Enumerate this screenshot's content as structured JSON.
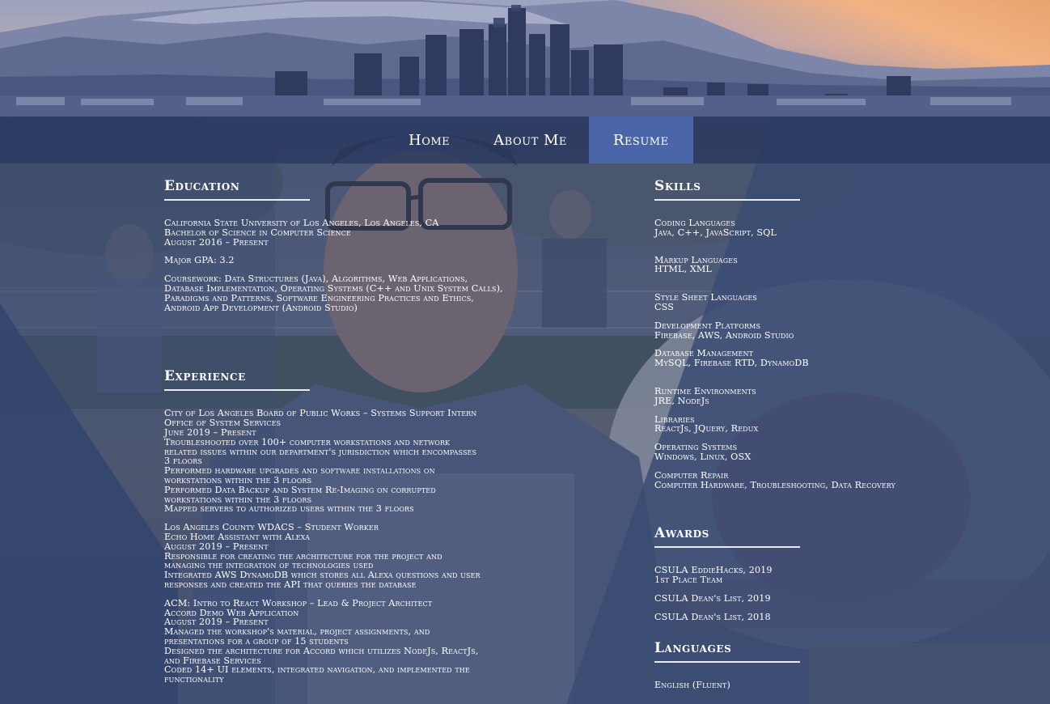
{
  "nav": {
    "items": [
      {
        "label": "Home",
        "active": false
      },
      {
        "label": "About Me",
        "active": false
      },
      {
        "label": "Resume",
        "active": true
      }
    ]
  },
  "education": {
    "title": "Education",
    "school": "California State University of Los Angeles, Los Angeles, CA",
    "degree": "Bachelor of Science  in Computer Science",
    "dates": "August 2016 – Present",
    "gpa": "Major GPA: 3.2",
    "coursework": [
      "Coursework: Data Structures (Java), Algorithms, Web Applications,",
      "Database Implementation, Operating Systems (C++ and Unix System Calls),",
      "Paradigms and Patterns, Software Engineering Practices and Ethics,",
      "Android App Development (Android Studio)"
    ]
  },
  "experience": {
    "title": "Experience",
    "jobs": [
      {
        "lines": [
          "City of Los Angeles Board of Public Works – Systems Support Intern",
          "Office of System Services",
          "June 2019 – Present",
          "Troubleshooted over 100+ computer workstations and network",
          "related issues within our department's jurisdiction which encompasses",
          "3 floors",
          "Performed hardware upgrades and software installations on",
          "workstations within the 3 floors",
          "Performed Data Backup and System Re-Imaging on corrupted",
          "workstations within the 3 floors",
          "Mapped servers to authorized users within the 3 floors"
        ]
      },
      {
        "lines": [
          "Los Angeles County WDACS – Student Worker",
          "Echo Home Assistant with Alexa",
          "August 2019 – Present",
          "Responsible for creating the architecture for the project and",
          "managing the integration of technologies used",
          "Integrated AWS DynamoDB which stores all Alexa questions and user",
          "responses and created the API that queries the database"
        ]
      },
      {
        "lines": [
          "ACM: Intro to React Workshop – Lead & Project Architect",
          "Accord  Demo Web Application",
          "August 2019 – Present",
          "Managed the  workshop's material, project assignments, and",
          "presentations for a group of 15 students",
          "Designed the architecture for Accord which utilizes NodeJs,  ReactJs,",
          "and Firebase Services",
          "Coded 14+ UI elements, integrated navigation, and implemented the",
          "functionality"
        ]
      }
    ]
  },
  "skills": {
    "title": "Skills",
    "groups": [
      {
        "name": "Coding Languages",
        "value": "Java, C++, JavaScript, SQL"
      },
      {
        "name": "Markup Languages",
        "value": "HTML, XML"
      },
      {
        "name": "Style Sheet Languages",
        "value": "CSS"
      },
      {
        "name": "Development Platforms",
        "value": "Firebase, AWS, Android Studio"
      },
      {
        "name": "Database Management",
        "value": "MySQL, Firebase RTD, DynamoDB"
      },
      {
        "name": "Runtime Environments",
        "value": "JRE, NodeJs"
      },
      {
        "name": "Libraries",
        "value": "ReactJs, JQuery, Redux"
      },
      {
        "name": "Operating Systems",
        "value": "Windows, Linux, OSX"
      },
      {
        "name": "Computer Repair",
        "value": "Computer Hardware, Troubleshooting, Data Recovery"
      }
    ]
  },
  "awards": {
    "title": "Awards",
    "items": [
      {
        "lines": [
          "CSULA EddieHacks, 2019",
          "1st Place Team"
        ]
      },
      {
        "lines": [
          "CSULA Dean's List, 2019"
        ]
      },
      {
        "lines": [
          "CSULA Dean's List, 2018"
        ]
      }
    ]
  },
  "languages": {
    "title": "Languages",
    "items": [
      "English (Fluent)"
    ]
  },
  "colors": {
    "panel": "#3a4b73",
    "nav_bg": "#28375f",
    "nav_active": "#4a66a8",
    "text": "#ffffff"
  }
}
